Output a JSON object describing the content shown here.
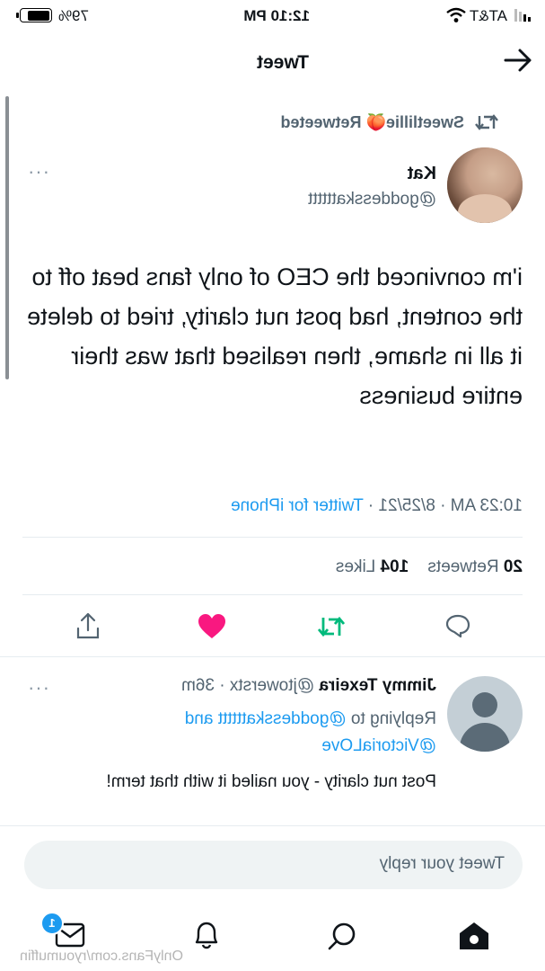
{
  "status_bar": {
    "carrier": "AT&T",
    "time": "12:10 PM",
    "battery": "79%"
  },
  "header": {
    "title": "Tweet"
  },
  "retweet_context": {
    "user": "Sweetlillie",
    "emoji": "🍑",
    "action": "Retweeted"
  },
  "tweet": {
    "name": "Kat",
    "handle": "@goddesskatttttt",
    "text": "i'm convinced the CEO of only fans beat off to the content, had post nut clarity, tried to delete it all in shame, then realised that was their entire business",
    "time": "10:23 AM",
    "date": "8/25/21",
    "source": "Twitter for iPhone",
    "retweets": "20",
    "retweets_label": "Retweets",
    "likes": "104",
    "likes_label": "Likes"
  },
  "reply": {
    "name": "Jimmy Texeira",
    "handle": "@jtowerstx",
    "age": "36m",
    "replying_to_prefix": "Replying to",
    "replying_to_user1": "@goddesskatttttt",
    "replying_to_and": "and",
    "replying_to_user2": "@VictoriaLOve",
    "text": "Post nut clarity - you nailed it with that term!"
  },
  "composer": {
    "placeholder": "Tweet your reply"
  },
  "bottom_nav": {
    "messages_badge": "1"
  },
  "watermark": "OnlyFans.com/ryoumuffin",
  "colors": {
    "accent": "#1d9bf0",
    "like": "#f91880",
    "retweet": "#00ba7c"
  }
}
